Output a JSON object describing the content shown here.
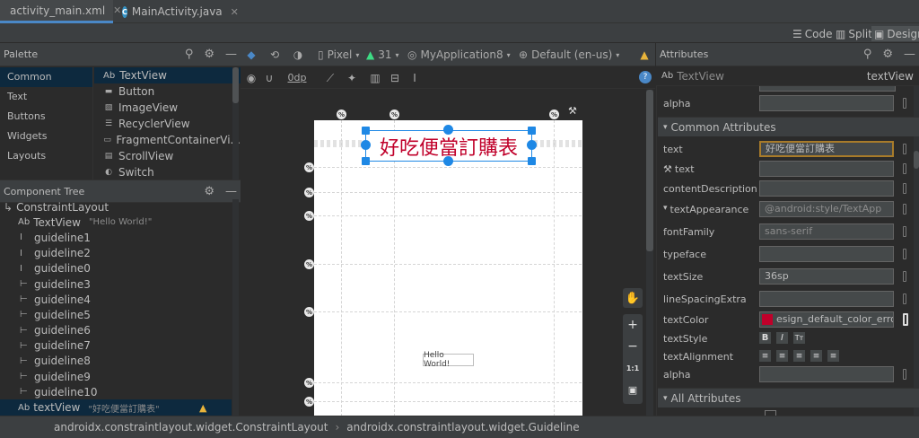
{
  "tabs": [
    {
      "label": "activity_main.xml",
      "icon": "xml-layout-icon",
      "active": true
    },
    {
      "label": "MainActivity.java",
      "icon": "java-class-icon",
      "active": false
    }
  ],
  "view_modes": {
    "code": "Code",
    "split": "Split",
    "design": "Design"
  },
  "palette": {
    "title": "Palette",
    "categories": [
      "Common",
      "Text",
      "Buttons",
      "Widgets",
      "Layouts"
    ],
    "items": [
      {
        "prefix": "Ab",
        "label": "TextView"
      },
      {
        "label": "Button"
      },
      {
        "label": "ImageView"
      },
      {
        "label": "RecyclerView"
      },
      {
        "label": "FragmentContainerVi..."
      },
      {
        "label": "ScrollView"
      },
      {
        "label": "Switch"
      }
    ]
  },
  "toolbar": {
    "device": "Pixel",
    "api": "31",
    "app": "MyApplication8",
    "locale": "Default (en-us)",
    "margin": "0dp"
  },
  "component_tree": {
    "title": "Component Tree",
    "root": "ConstraintLayout",
    "textview1": {
      "prefix": "Ab",
      "label": "TextView",
      "sub": "\"Hello World!\""
    },
    "guidelines": [
      "guideline1",
      "guideline2",
      "guideline0",
      "guideline3",
      "guideline4",
      "guideline5",
      "guideline6",
      "guideline7",
      "guideline8",
      "guideline9",
      "guideline10"
    ],
    "textview2": {
      "prefix": "Ab",
      "label": "textView",
      "sub": "\"好吃便當訂購表\""
    }
  },
  "canvas": {
    "title_text": "好吃便當訂購表",
    "title_color": "#c0002a",
    "hello": "Hello World!",
    "pct": "%",
    "zoom_label": "1:1"
  },
  "attributes": {
    "title": "Attributes",
    "widget_type": "TextView",
    "widget_prefix": "Ab",
    "widget_id": "textView",
    "alpha_top": "alpha",
    "common_section": "Common Attributes",
    "text_label": "text",
    "text_value": "好吃便當訂購表",
    "tools_text_label": "text",
    "content_desc": "contentDescription",
    "text_appearance": "textAppearance",
    "text_appearance_value": "@android:style/TextApp",
    "font_family": "fontFamily",
    "font_family_value": "sans-serif",
    "typeface": "typeface",
    "text_size": "textSize",
    "text_size_value": "36sp",
    "line_spacing": "lineSpacingExtra",
    "text_color": "textColor",
    "text_color_value": "esign_default_color_error",
    "text_color_swatch": "#c0002a",
    "text_style": "textStyle",
    "text_alignment": "textAlignment",
    "alpha": "alpha",
    "all_section": "All Attributes"
  },
  "status": {
    "crumb1": "androidx.constraintlayout.widget.ConstraintLayout",
    "crumb2": "androidx.constraintlayout.widget.Guideline"
  }
}
